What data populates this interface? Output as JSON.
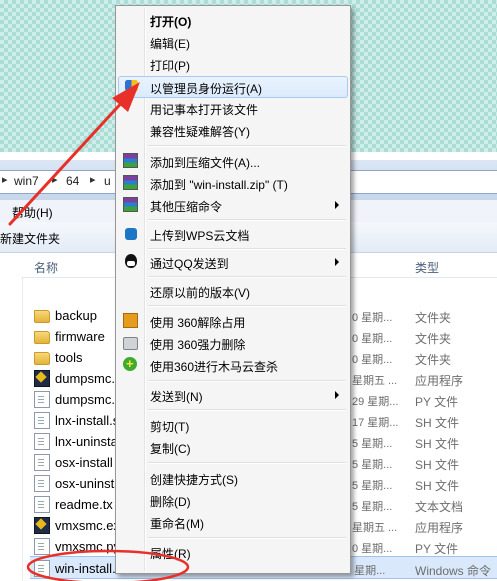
{
  "breadcrumb": {
    "seg1": "win7",
    "seg2": "64",
    "seg3": "u"
  },
  "menubar": {
    "help": "帮助(H)"
  },
  "command_bar": {
    "new_folder": "新建文件夹"
  },
  "columns": {
    "name": "名称",
    "type": "类型"
  },
  "files": [
    {
      "name": "backup",
      "date": "0 星期...",
      "type": "文件夹",
      "icon": "folder-icon"
    },
    {
      "name": "firmware",
      "date": "0 星期...",
      "type": "文件夹",
      "icon": "folder-icon"
    },
    {
      "name": "tools",
      "date": "0 星期...",
      "type": "文件夹",
      "icon": "folder-icon"
    },
    {
      "name": "dumpsmc.",
      "date": "星期五 ...",
      "type": "应用程序",
      "icon": "vmware-exe-icon"
    },
    {
      "name": "dumpsmc.",
      "date": "29 星期...",
      "type": "PY 文件",
      "icon": "document-icon"
    },
    {
      "name": "lnx-install.s",
      "date": "17 星期...",
      "type": "SH 文件",
      "icon": "document-icon"
    },
    {
      "name": "lnx-uninsta",
      "date": "5 星期...",
      "type": "SH 文件",
      "icon": "document-icon"
    },
    {
      "name": "osx-install",
      "date": "5 星期...",
      "type": "SH 文件",
      "icon": "document-icon"
    },
    {
      "name": "osx-uninst",
      "date": "5 星期...",
      "type": "SH 文件",
      "icon": "document-icon"
    },
    {
      "name": "readme.tx",
      "date": "5 星期...",
      "type": "文本文档",
      "icon": "document-icon"
    },
    {
      "name": "vmxsmc.ex",
      "date": "星期五 ...",
      "type": "应用程序",
      "icon": "vmware-exe-icon"
    },
    {
      "name": "vmxsmc.py",
      "date": "0 星期...",
      "type": "PY 文件",
      "icon": "document-icon"
    }
  ],
  "selected_file": {
    "name": "win-install.cmd",
    "date": "2014/12/14 星期...",
    "type": "Windows 命令"
  },
  "context_menu": {
    "open": "打开(O)",
    "edit": "编辑(E)",
    "print": "打印(P)",
    "run_as_admin": "以管理员身份运行(A)",
    "open_with_notepad": "用记事本打开该文件",
    "compat_troubleshoot": "兼容性疑难解答(Y)",
    "add_to_archive": "添加到压缩文件(A)...",
    "add_to_zip": "添加到 \"win-install.zip\" (T)",
    "other_compress": "其他压缩命令",
    "upload_wps": "上传到WPS云文档",
    "send_via_qq": "通过QQ发送到",
    "restore_prev": "还原以前的版本(V)",
    "unlock_360": "使用 360解除占用",
    "force_delete_360": "使用 360强力删除",
    "trojan_scan_360": "使用360进行木马云查杀",
    "send_to": "发送到(N)",
    "cut": "剪切(T)",
    "copy": "复制(C)",
    "create_shortcut": "创建快捷方式(S)",
    "delete": "删除(D)",
    "rename": "重命名(M)",
    "properties": "属性(R)"
  },
  "colors": {
    "annotation": "#e8302a",
    "menu_highlight": "#dbeafc"
  }
}
